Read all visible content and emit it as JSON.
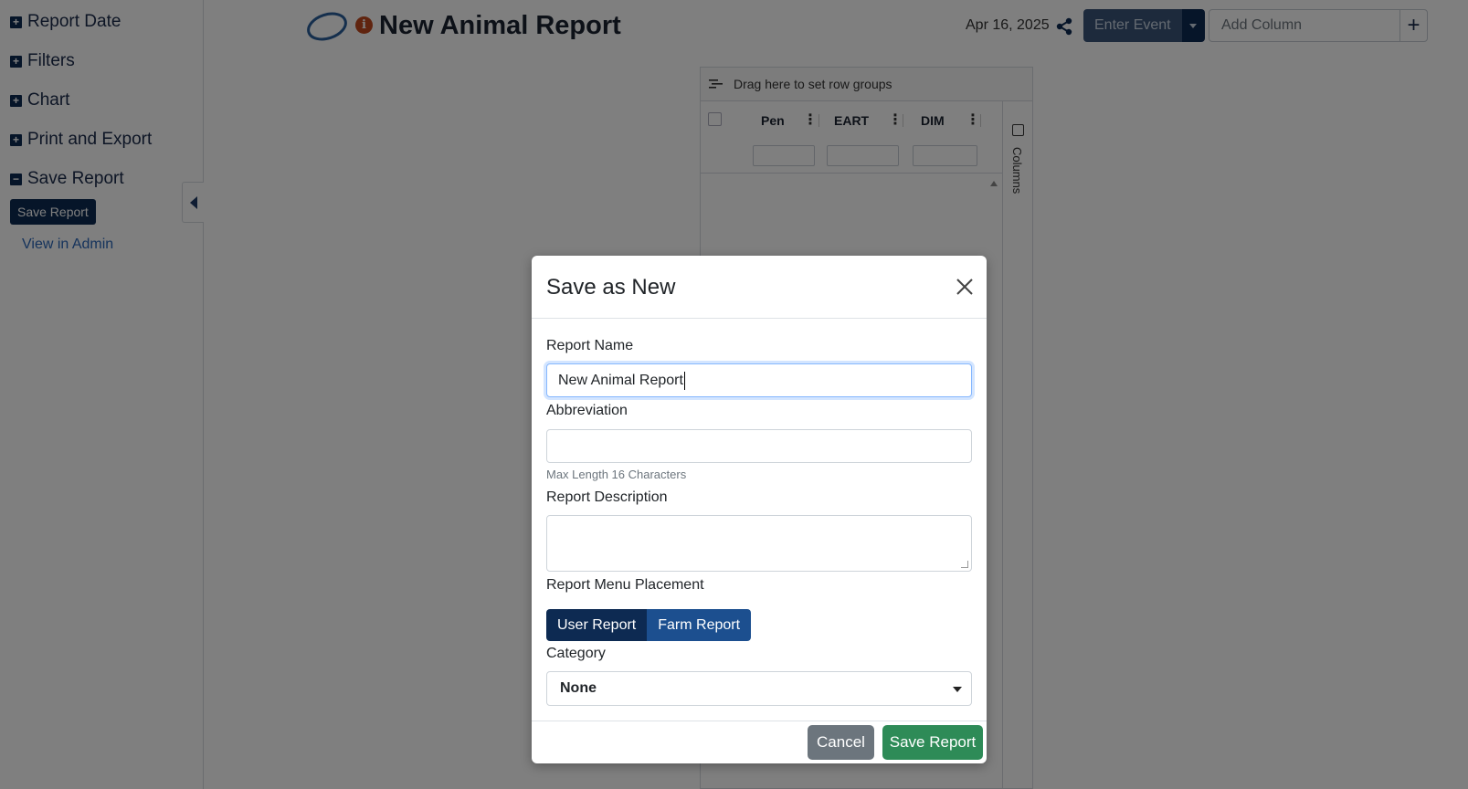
{
  "sidebar": {
    "items": [
      {
        "label": "Report Date",
        "state": "+"
      },
      {
        "label": "Filters",
        "state": "+"
      },
      {
        "label": "Chart",
        "state": "+"
      },
      {
        "label": "Print and Export",
        "state": "+"
      },
      {
        "label": "Save Report",
        "state": "−"
      }
    ],
    "save_button": "Save Report",
    "admin_link": "View in Admin"
  },
  "header": {
    "title": "New Animal Report",
    "info_glyph": "i",
    "date": "Apr 16, 2025",
    "enter_event": "Enter Event",
    "add_column_placeholder": "Add Column",
    "add_glyph": "+"
  },
  "grid": {
    "group_bar_text": "Drag here to set row groups",
    "columns": [
      "Pen",
      "EART",
      "DIM"
    ],
    "side_panel_label": "Columns"
  },
  "modal": {
    "title": "Save as New",
    "report_name_label": "Report Name",
    "report_name_value": "New Animal Report",
    "abbreviation_label": "Abbreviation",
    "abbreviation_value": "",
    "abbreviation_hint": "Max Length 16 Characters",
    "description_label": "Report Description",
    "description_value": "",
    "placement_label": "Report Menu Placement",
    "placement_options": [
      "User Report",
      "Farm Report"
    ],
    "placement_selected": "User Report",
    "category_label": "Category",
    "category_value": "None",
    "cancel_label": "Cancel",
    "save_label": "Save Report"
  },
  "colors": {
    "navy": "#0d2a52",
    "blue": "#1c4f8f",
    "green": "#2e8b57",
    "gray": "#6c757d",
    "info": "#c0491e"
  },
  "icons": {
    "logo": "oval-logo-icon",
    "info": "info-icon",
    "share": "share-icon",
    "close": "close-icon",
    "collapse": "chevron-left-icon",
    "groups": "row-groups-icon",
    "columns": "columns-icon"
  }
}
